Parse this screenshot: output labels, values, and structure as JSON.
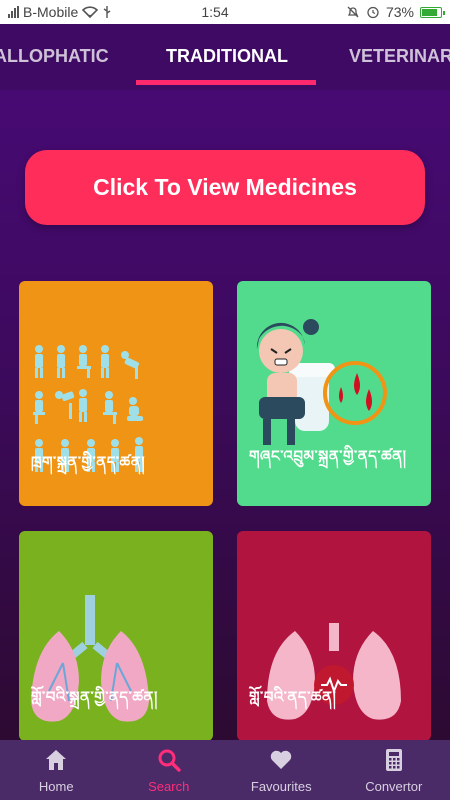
{
  "status_bar": {
    "carrier": "B-Mobile",
    "time": "1:54",
    "battery": "73%",
    "battery_level": 0.73
  },
  "tabs": [
    {
      "label": "ALLOPHATIC",
      "active": false
    },
    {
      "label": "TRADITIONAL",
      "active": true
    },
    {
      "label": "VETERINARY",
      "active": false
    }
  ],
  "cta": {
    "label": "Click To View Medicines"
  },
  "cards": [
    {
      "label": "ཁྲག་སྐྲན་གྱི་ནད་ཚན།",
      "color": "#ef9415",
      "icon": "symptoms-figures-icon"
    },
    {
      "label": "གཞང་འབྲུམ་སྐྲན་གྱི་ནད་ཚན།",
      "color": "#52db8c",
      "icon": "hemorrhoid-girl-icon"
    },
    {
      "label": "གློ་བའི་སྐྲན་གྱི་ནད་ཚན།",
      "color": "#79b21e",
      "icon": "lungs-icon"
    },
    {
      "label": "གློ་བའི་ནད་ཚན།",
      "color": "#b0143f",
      "icon": "lungs-heart-icon"
    }
  ],
  "bottom_nav": [
    {
      "label": "Home",
      "icon": "home-icon",
      "active": false
    },
    {
      "label": "Search",
      "icon": "search-icon",
      "active": true
    },
    {
      "label": "Favourites",
      "icon": "heart-icon",
      "active": false
    },
    {
      "label": "Convertor",
      "icon": "calculator-icon",
      "active": false
    }
  ],
  "colors": {
    "accent": "#ff2d5a",
    "tab_indicator": "#ff2a6d",
    "nav_active": "#ff2d7a",
    "header_bg": "#3e0a64",
    "nav_bg": "#4b2a68"
  }
}
